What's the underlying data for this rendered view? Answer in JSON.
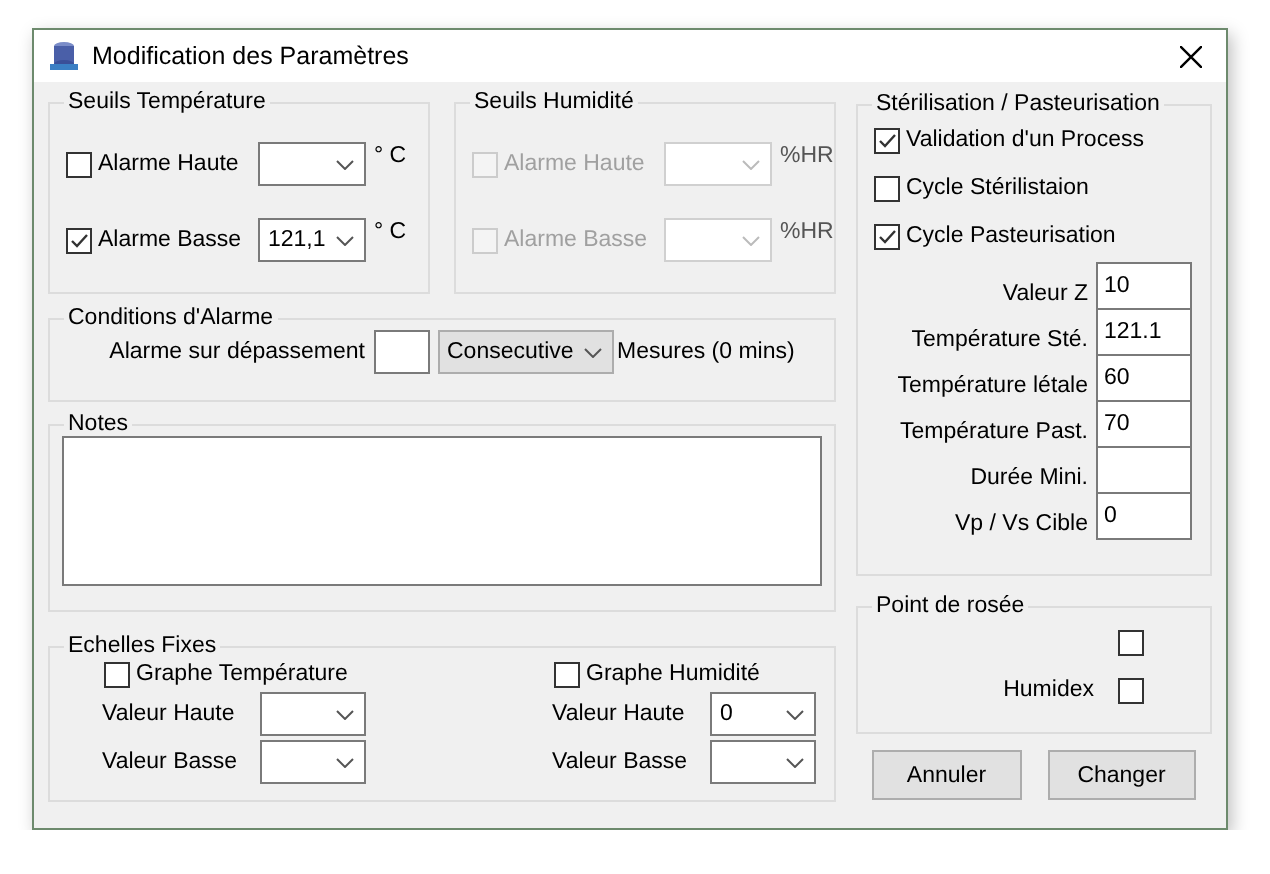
{
  "window": {
    "title": "Modification des Paramètres"
  },
  "temperature_thresholds": {
    "title": "Seuils Température",
    "rows": [
      {
        "label": "Alarme Haute",
        "checked": false,
        "disabled": false,
        "unit": "° C"
      },
      {
        "label": "Alarme Basse",
        "checked": true,
        "disabled": false,
        "value": "121,1",
        "unit": "° C"
      }
    ]
  },
  "humidity_thresholds": {
    "title": "Seuils Humidité",
    "rows": [
      {
        "label": "Alarme Haute",
        "checked": false,
        "disabled": true,
        "unit": "%HR"
      },
      {
        "label": "Alarme Basse",
        "checked": false,
        "disabled": true,
        "unit": "%HR"
      }
    ]
  },
  "alarm_conditions": {
    "title": "Conditions d'Alarme",
    "label": "Alarme sur dépassement",
    "mode": "Consecutive",
    "suffix": "Mesures (0 mins)"
  },
  "notes": {
    "title": "Notes"
  },
  "fixed_scales": {
    "title": "Echelles Fixes",
    "groups": [
      {
        "label": "Graphe Température",
        "checked": false,
        "fields": [
          {
            "label": "Valeur Haute"
          },
          {
            "label": "Valeur Basse"
          }
        ]
      },
      {
        "label": "Graphe Humidité",
        "checked": false,
        "fields": [
          {
            "label": "Valeur Haute",
            "value": "0"
          },
          {
            "label": "Valeur Basse"
          }
        ]
      }
    ]
  },
  "sterilization": {
    "title": "Stérilisation  / Pasteurisation",
    "options": [
      {
        "label": "Validation d'un Process",
        "checked": true
      },
      {
        "label": "Cycle Stérilistaion",
        "checked": false
      },
      {
        "label": "Cycle Pasteurisation",
        "checked": true
      }
    ],
    "fields": [
      {
        "label": "Valeur Z",
        "value": "10"
      },
      {
        "label": "Température Sté.",
        "value": "121.1"
      },
      {
        "label": "Température létale",
        "value": "60"
      },
      {
        "label": "Température Past.",
        "value": "70"
      },
      {
        "label": "Durée Mini."
      },
      {
        "label": "Vp / Vs Cible",
        "value": "0"
      }
    ]
  },
  "dew_point": {
    "title": "Point de rosée",
    "options": [
      {
        "checked": false
      },
      {
        "label": "Humidex",
        "checked": false
      }
    ]
  },
  "buttons": [
    "Annuler",
    "Changer"
  ]
}
